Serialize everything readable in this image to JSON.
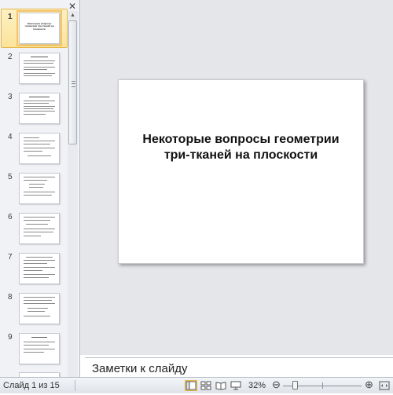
{
  "thumbnails": [
    {
      "num": "1",
      "title": "Некоторые вопросы геометрии три-тканей на плоскости"
    },
    {
      "num": "2"
    },
    {
      "num": "3"
    },
    {
      "num": "4"
    },
    {
      "num": "5"
    },
    {
      "num": "6"
    },
    {
      "num": "7"
    },
    {
      "num": "8"
    },
    {
      "num": "9"
    }
  ],
  "slide": {
    "title": "Некоторые  вопросы геометрии  три-тканей  на плоскости"
  },
  "notes": {
    "placeholder": "Заметки к слайду"
  },
  "status": {
    "slide_counter": "Слайд 1 из 15",
    "zoom": "32%",
    "zoom_level_fraction": 0.32
  },
  "icons": {
    "close": "close-icon",
    "normal_view": "normal-view-icon",
    "sorter_view": "slide-sorter-icon",
    "reading_view": "reading-view-icon",
    "slideshow_view": "slideshow-icon",
    "fit": "fit-to-window-icon"
  },
  "colors": {
    "selection_fill": "#fbe49a",
    "selection_border": "#e6b84b",
    "pane_bg": "#f0f2f5",
    "canvas_bg": "#e4e6ea"
  }
}
